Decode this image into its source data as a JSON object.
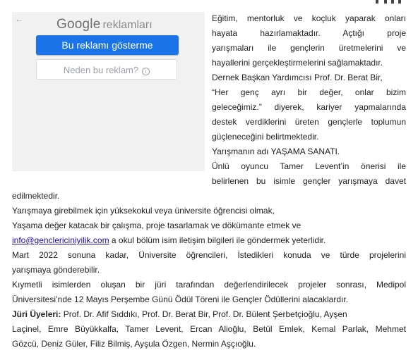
{
  "ad": {
    "back_icon": "back-arrow-icon",
    "brand_google": "Google",
    "brand_suffix": "reklamları",
    "primary_button": "Bu reklamı gösterme",
    "secondary_button": "Neden bu reklam?",
    "info_icon": "info-icon",
    "info_glyph": "i"
  },
  "article": {
    "p1": [
      "Eğitim, mentorluk ve koçluk yaparak onları",
      "hayata hazırlamaktadır. Açtığı proje",
      "yarışmaları ile gençlerin üretmelerini ve",
      "hayallerini gerçekleştirmelerini sağlamaktadır."
    ],
    "p2": [
      "Dernek Başkan Yardımcısı Prof. Dr. Berat Bir,",
      "“Her genç ayrı bir değer, onlar bizim",
      "geleceğimiz.” diyerek, kariyer yapmalarında",
      "destek verdiklerini üreten gençlerle toplumun",
      "güçleneceğini belirtmektedir."
    ],
    "p3": "Yarışmanın adı YAŞAMA SANATI.",
    "p4": [
      "Ünlü oyuncu Tamer Levent’in önerisi ile",
      "belirlenen bu isimle gençler yarışmaya davet",
      "edilmektedir."
    ],
    "p5": "Yarışmaya girebilmek için yüksekokul veya üniversite öğrencisi olmak,",
    "p6": "Yaşama değer katacak bir çalışma, proje tasarlamak ve dökümante etmek ve",
    "p7_link": "info@genclericiniyilik.com",
    "p7_rest": " a okul bölüm isim iletişim bilgileri ile göndermek yeterlidir.",
    "p8": [
      "Mart 2022 sonuna kadar, Üniversite öğrencileri, İstedikleri konuda ve türde projelerini",
      "yarışmaya gönderebilir."
    ],
    "p9": [
      "Kıymetli isimlerden oluşan bir jüri tarafından değerlendirilecek projeler sonrası, Medipol",
      "Üniversitesi’nde 12 Mayıs Perşembe Günü Ödül Töreni ile Gençler Ödüllerini alacaklardır."
    ],
    "jury_label": "Jüri Üyeleri:",
    "jury_line1": " Prof. Dr. Afif Sıddıkı, Prof. Dr. Berat Bir, Prof. Dr. Bülent Şerbetçioğlu, Ayşen",
    "jury_line2": "Laçinel, Emre Büyükkalfa, Tamer Levent, Ercan Alioğlu, Betül Emlek, Kemal Parlak, Mehmet",
    "jury_line3": "Gözcü, Deniz Güler, Filiz Bilmiş, Ayşula Özgen, Nermin Aşçıoğlu."
  }
}
